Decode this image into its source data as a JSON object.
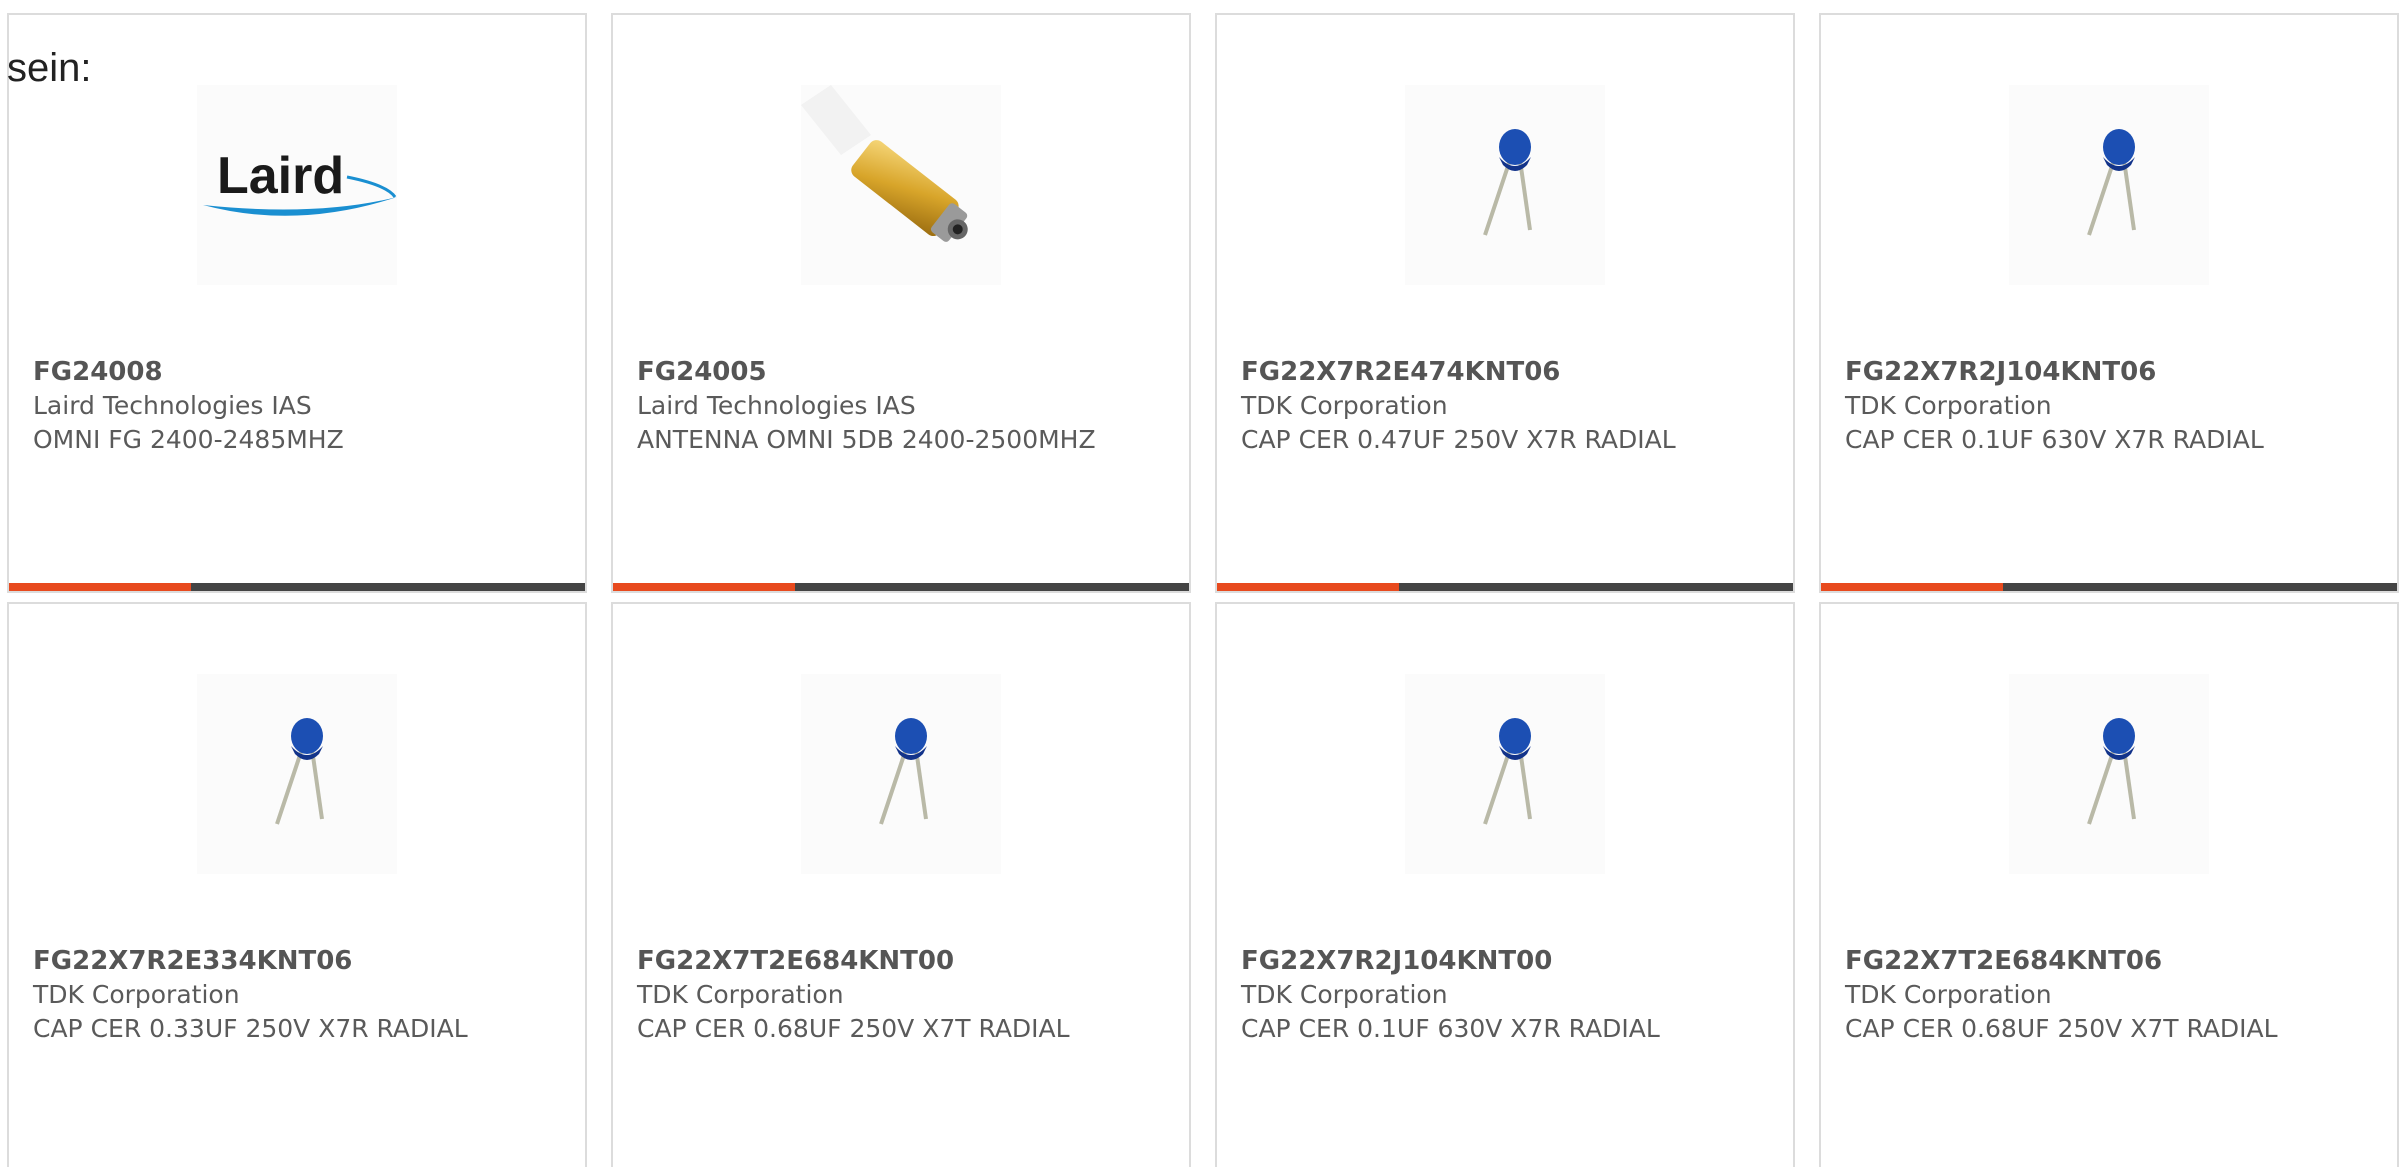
{
  "lead_text": "sein:",
  "colors": {
    "accent_bar": "#e84a1e",
    "dark_bar": "#444444",
    "card_border": "#dcdcdc",
    "laird_blue": "#1a8fd1",
    "capacitor_blue": "#1c4fb3",
    "antenna_gold": "#d8a52a"
  },
  "products": [
    {
      "part_number": "FG24008",
      "manufacturer": "Laird Technologies IAS",
      "description": "OMNI FG 2400-2485MHZ",
      "image_icon": "laird-logo",
      "logo_text": "Laird"
    },
    {
      "part_number": "FG24005",
      "manufacturer": "Laird Technologies IAS",
      "description": "ANTENNA OMNI 5DB 2400-2500MHZ",
      "image_icon": "antenna-icon"
    },
    {
      "part_number": "FG22X7R2E474KNT06",
      "manufacturer": "TDK Corporation",
      "description": "CAP CER 0.47UF 250V X7R RADIAL",
      "image_icon": "capacitor-icon"
    },
    {
      "part_number": "FG22X7R2J104KNT06",
      "manufacturer": "TDK Corporation",
      "description": "CAP CER 0.1UF 630V X7R RADIAL",
      "image_icon": "capacitor-icon"
    },
    {
      "part_number": "FG22X7R2E334KNT06",
      "manufacturer": "TDK Corporation",
      "description": "CAP CER 0.33UF 250V X7R RADIAL",
      "image_icon": "capacitor-icon"
    },
    {
      "part_number": "FG22X7T2E684KNT00",
      "manufacturer": "TDK Corporation",
      "description": "CAP CER 0.68UF 250V X7T RADIAL",
      "image_icon": "capacitor-icon"
    },
    {
      "part_number": "FG22X7R2J104KNT00",
      "manufacturer": "TDK Corporation",
      "description": "CAP CER 0.1UF 630V X7R RADIAL",
      "image_icon": "capacitor-icon"
    },
    {
      "part_number": "FG22X7T2E684KNT06",
      "manufacturer": "TDK Corporation",
      "description": "CAP CER 0.68UF 250V X7T RADIAL",
      "image_icon": "capacitor-icon"
    }
  ]
}
